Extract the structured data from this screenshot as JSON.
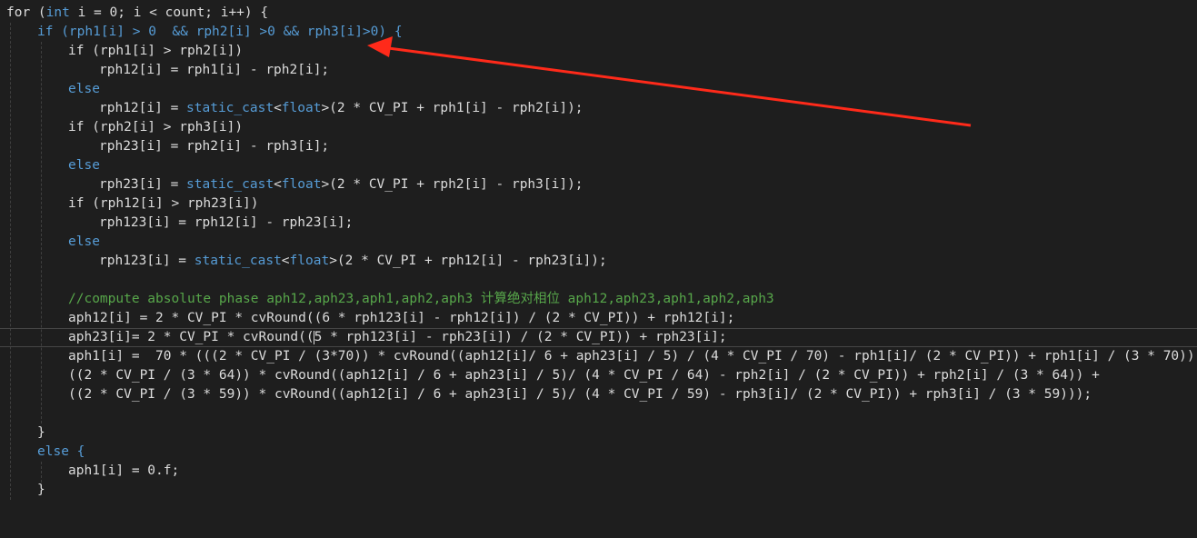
{
  "editor": {
    "lines": [
      [
        "for (",
        "int",
        " i = 0; i < count; i++) {"
      ],
      [
        "if (rph1[i] > 0  && rph2[i] >0 && rph3[i]>0) {"
      ],
      [
        "if (rph1[i] > rph2[i])"
      ],
      [
        "rph12[i] = rph1[i] - rph2[i];"
      ],
      [
        "else"
      ],
      [
        "rph12[i] = ",
        "static_cast",
        "<",
        "float",
        ">(2 * CV_PI + rph1[i] - rph2[i]);"
      ],
      [
        "if (rph2[i] > rph3[i])"
      ],
      [
        "rph23[i] = rph2[i] - rph3[i];"
      ],
      [
        "else"
      ],
      [
        "rph23[i] = ",
        "static_cast",
        "<",
        "float",
        ">(2 * CV_PI + rph2[i] - rph3[i]);"
      ],
      [
        "if (rph12[i] > rph23[i])"
      ],
      [
        "rph123[i] = rph12[i] - rph23[i];"
      ],
      [
        "else"
      ],
      [
        "rph123[i] = ",
        "static_cast",
        "<",
        "float",
        ">(2 * CV_PI + rph12[i] - rph23[i]);"
      ],
      [
        ""
      ],
      [
        "//compute absolute phase aph12,aph23,aph1,aph2,aph3 计算绝对相位 aph12,aph23,aph1,aph2,aph3"
      ],
      [
        "aph12[i] = 2 * CV_PI * cvRound((6 * rph123[i] - rph12[i]) / (2 * CV_PI)) + rph12[i];"
      ],
      [
        "aph23[i]= 2 * CV_PI * cvRound((",
        "5 * rph123[i] - rph23[i]) / (2 * CV_PI)) + rph23[i];"
      ],
      [
        "aph1[i] =  70 * (((2 * CV_PI / (3*70)) * cvRound((aph12[i]/ 6 + aph23[i] / 5) / (4 * CV_PI / 70) - rph1[i]/ (2 * CV_PI)) + rph1[i] / (3 * 70)) +"
      ],
      [
        "((2 * CV_PI / (3 * 64)) * cvRound((aph12[i] / 6 + aph23[i] / 5)/ (4 * CV_PI / 64) - rph2[i] / (2 * CV_PI)) + rph2[i] / (3 * 64)) +"
      ],
      [
        "((2 * CV_PI / (3 * 59)) * cvRound((aph12[i] / 6 + aph23[i] / 5)/ (4 * CV_PI / 59) - rph3[i]/ (2 * CV_PI)) + rph3[i] / (3 * 59)));"
      ],
      [
        ""
      ],
      [
        ""
      ],
      [
        "}"
      ],
      [
        "else {"
      ],
      [
        "aph1[i] = 0.f;"
      ],
      [
        "}"
      ]
    ]
  },
  "colors": {
    "background": "#1e1e1e",
    "text": "#dcdcdc",
    "keyword": "#569cd6",
    "comment": "#57a64a",
    "annotation_arrow": "#ff2a1a"
  },
  "annotation": {
    "type": "arrow",
    "color": "#ff2a1a"
  }
}
